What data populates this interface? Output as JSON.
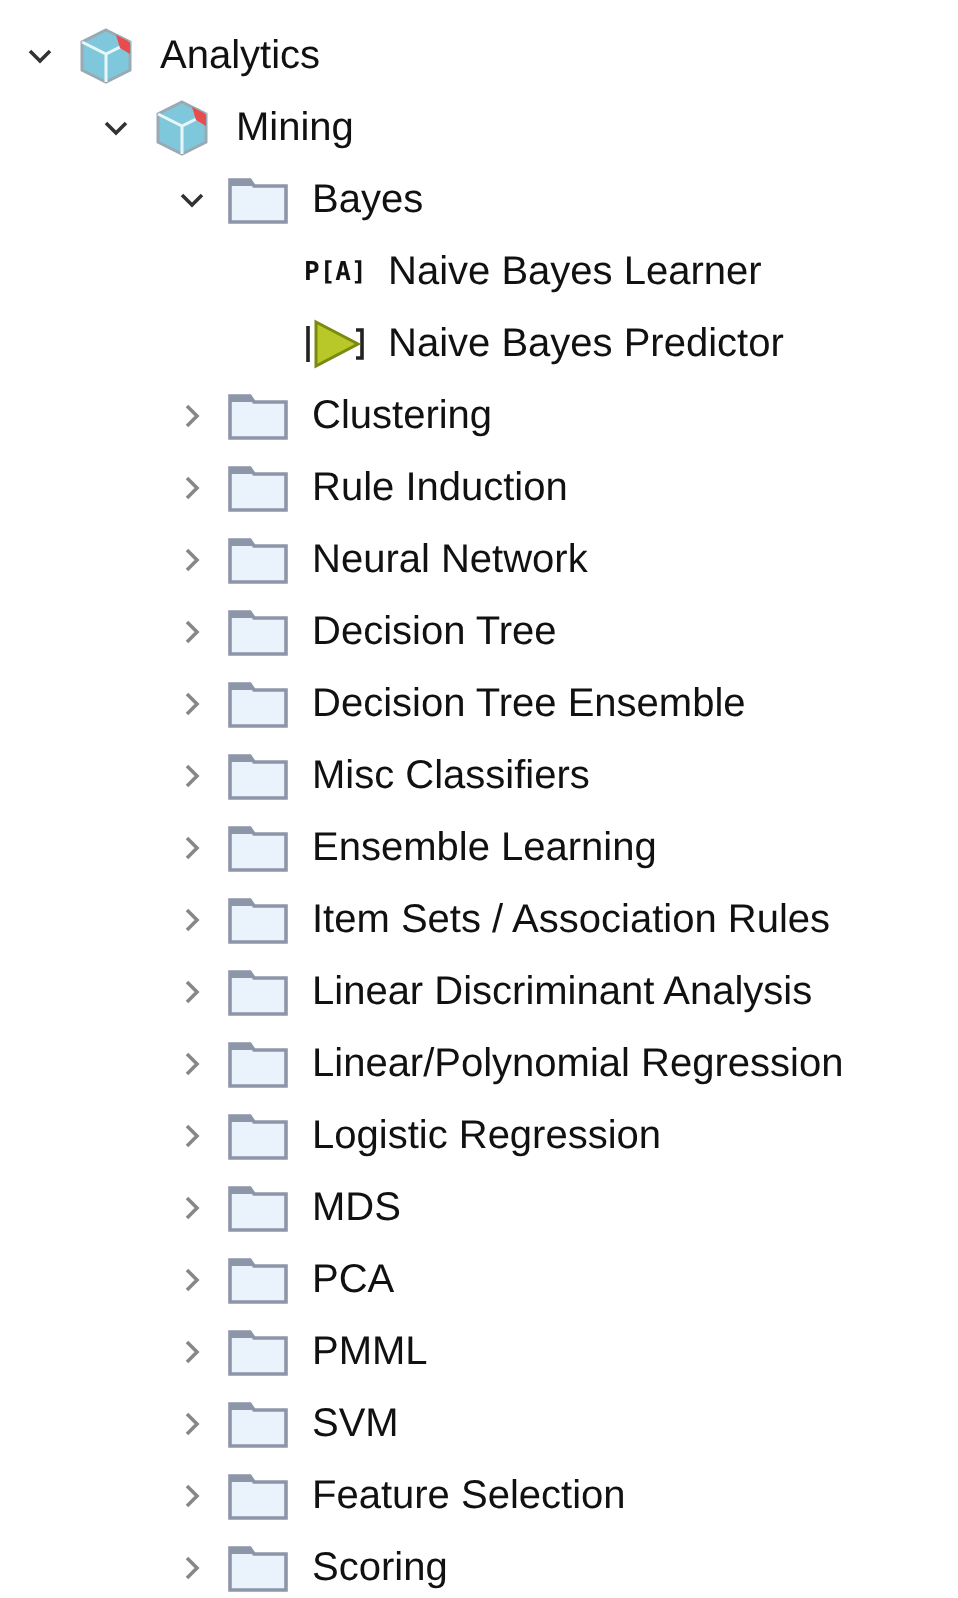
{
  "tree": [
    {
      "label": "Analytics",
      "kind": "category",
      "expanded": true,
      "children": [
        {
          "label": "Mining",
          "kind": "category",
          "expanded": true,
          "children": [
            {
              "label": "Bayes",
              "kind": "folder",
              "expanded": true,
              "children": [
                {
                  "label": "Naive Bayes Learner",
                  "kind": "learner",
                  "icon_text": "P[A]"
                },
                {
                  "label": "Naive Bayes Predictor",
                  "kind": "predictor"
                }
              ]
            },
            {
              "label": "Clustering",
              "kind": "folder",
              "expanded": false
            },
            {
              "label": "Rule Induction",
              "kind": "folder",
              "expanded": false
            },
            {
              "label": "Neural Network",
              "kind": "folder",
              "expanded": false
            },
            {
              "label": "Decision Tree",
              "kind": "folder",
              "expanded": false
            },
            {
              "label": "Decision Tree Ensemble",
              "kind": "folder",
              "expanded": false
            },
            {
              "label": "Misc Classifiers",
              "kind": "folder",
              "expanded": false
            },
            {
              "label": "Ensemble Learning",
              "kind": "folder",
              "expanded": false
            },
            {
              "label": "Item Sets / Association Rules",
              "kind": "folder",
              "expanded": false
            },
            {
              "label": "Linear Discriminant Analysis",
              "kind": "folder",
              "expanded": false
            },
            {
              "label": "Linear/Polynomial Regression",
              "kind": "folder",
              "expanded": false
            },
            {
              "label": "Logistic Regression",
              "kind": "folder",
              "expanded": false
            },
            {
              "label": "MDS",
              "kind": "folder",
              "expanded": false
            },
            {
              "label": "PCA",
              "kind": "folder",
              "expanded": false
            },
            {
              "label": "PMML",
              "kind": "folder",
              "expanded": false
            },
            {
              "label": "SVM",
              "kind": "folder",
              "expanded": false
            },
            {
              "label": "Feature Selection",
              "kind": "folder",
              "expanded": false
            },
            {
              "label": "Scoring",
              "kind": "folder",
              "expanded": false
            }
          ]
        }
      ]
    }
  ]
}
